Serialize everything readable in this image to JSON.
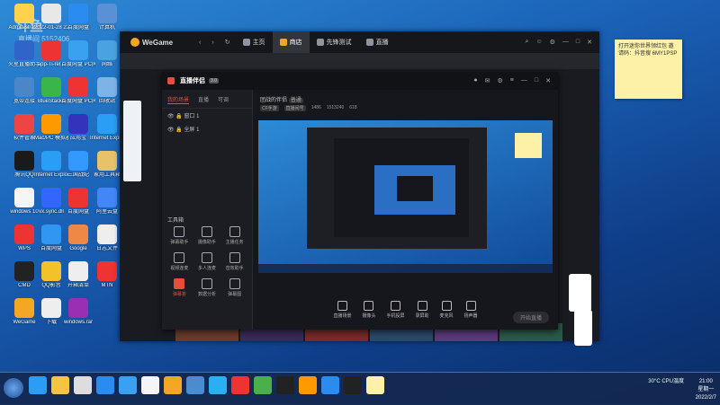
{
  "desktop_icons": [
    {
      "label": "Administrat...",
      "color": "#ffd24d"
    },
    {
      "label": "2022-01-28 22点0地1 截图.png",
      "color": "#e8e8e8"
    },
    {
      "label": "百度网盘",
      "color": "#2a8cf0"
    },
    {
      "label": "计算机",
      "color": "#5b8fd6"
    },
    {
      "label": "火星直播助手",
      "color": "#3064c8"
    },
    {
      "label": "app-Ti-rel...",
      "color": "#e33"
    },
    {
      "label": "百度网盘 PC同步助手",
      "color": "#3aa0f0"
    },
    {
      "label": "网络",
      "color": "#4aa3e0"
    },
    {
      "label": "宽带连接",
      "color": "#4a86c8"
    },
    {
      "label": "BlueStacks",
      "color": "#3ab54a"
    },
    {
      "label": "百度网盘 PC同步",
      "color": "#e33"
    },
    {
      "label": "回收站",
      "color": "#7fb3e8"
    },
    {
      "label": "软件管家",
      "color": "#e44"
    },
    {
      "label": "Mac/PC 模拟器",
      "color": "#f90"
    },
    {
      "label": "应用宝",
      "color": "#33b"
    },
    {
      "label": "Internet Explorer",
      "color": "#2a9df4"
    },
    {
      "label": "腾讯QQ",
      "color": "#1a1a1a"
    },
    {
      "label": "Internet Explorer",
      "color": "#2a9df4"
    },
    {
      "label": "三国战纪",
      "color": "#3399ff"
    },
    {
      "label": "家用工具箱",
      "color": "#e8c16b"
    },
    {
      "label": "windows 10",
      "color": "#f5f5f5"
    },
    {
      "label": "vx.sync.dll",
      "color": "#3366ff"
    },
    {
      "label": "百度网盘",
      "color": "#e33"
    },
    {
      "label": "阿里云盘",
      "color": "#4287f5"
    },
    {
      "label": "WPS",
      "color": "#e33"
    },
    {
      "label": "百度网盘",
      "color": "#2f97f2"
    },
    {
      "label": "Google",
      "color": "#e84"
    },
    {
      "label": "日志文件",
      "color": "#eee"
    },
    {
      "label": "CMD",
      "color": "#222"
    },
    {
      "label": "QQ影音",
      "color": "#f3c12a"
    },
    {
      "label": "开箱清单",
      "color": "#eee"
    },
    {
      "label": "MTN",
      "color": "#e33"
    },
    {
      "label": "WeGame",
      "color": "#f5a623"
    },
    {
      "label": "下载",
      "color": "#eee"
    },
    {
      "label": "windows.rar",
      "color": "#9b2fb3"
    }
  ],
  "watermark": {
    "line1": "斗鱼",
    "line2": "直播间 5152406"
  },
  "wegame": {
    "brand": "WeGame",
    "nav": [
      {
        "label": "主页",
        "active": false
      },
      {
        "label": "商店",
        "active": true
      },
      {
        "label": "先锋测试",
        "active": false
      },
      {
        "label": "直播",
        "active": false
      }
    ]
  },
  "live_app": {
    "brand": "直播伴侣",
    "version": "3.0",
    "left_tabs": [
      "我的场景",
      "直播",
      "可调"
    ],
    "scenes": [
      "窗口 1",
      "全屏 1"
    ],
    "tools_title": "工具箱",
    "tools": [
      {
        "label": "弹幕助手",
        "red": false
      },
      {
        "label": "摄像助手",
        "red": false
      },
      {
        "label": "主播任务",
        "red": false
      },
      {
        "label": "视频连麦",
        "red": false
      },
      {
        "label": "多人连麦",
        "red": false
      },
      {
        "label": "音效助手",
        "red": false
      },
      {
        "label": "弹幕答",
        "red": true
      },
      {
        "label": "数据分析",
        "red": false
      },
      {
        "label": "弹幕图",
        "red": false
      }
    ],
    "room_name": "团战的伴侣",
    "room_tag": "普通",
    "meta": [
      "CF手游",
      "直播间号",
      "1486",
      "1513240",
      "618"
    ],
    "bottom_buttons": [
      "直播场景",
      "摄像头",
      "手机投屏",
      "录屏助",
      "麦克风",
      "扬声器"
    ],
    "start_live": "开始直播"
  },
  "sticky_note": "打开迷你世界领红包 邀请码：抖音搜 6MY1PSP",
  "clock": {
    "time": "21:00",
    "date": "2022/2/7",
    "day": "星期一"
  },
  "tray_text": "30°C CPU温度"
}
